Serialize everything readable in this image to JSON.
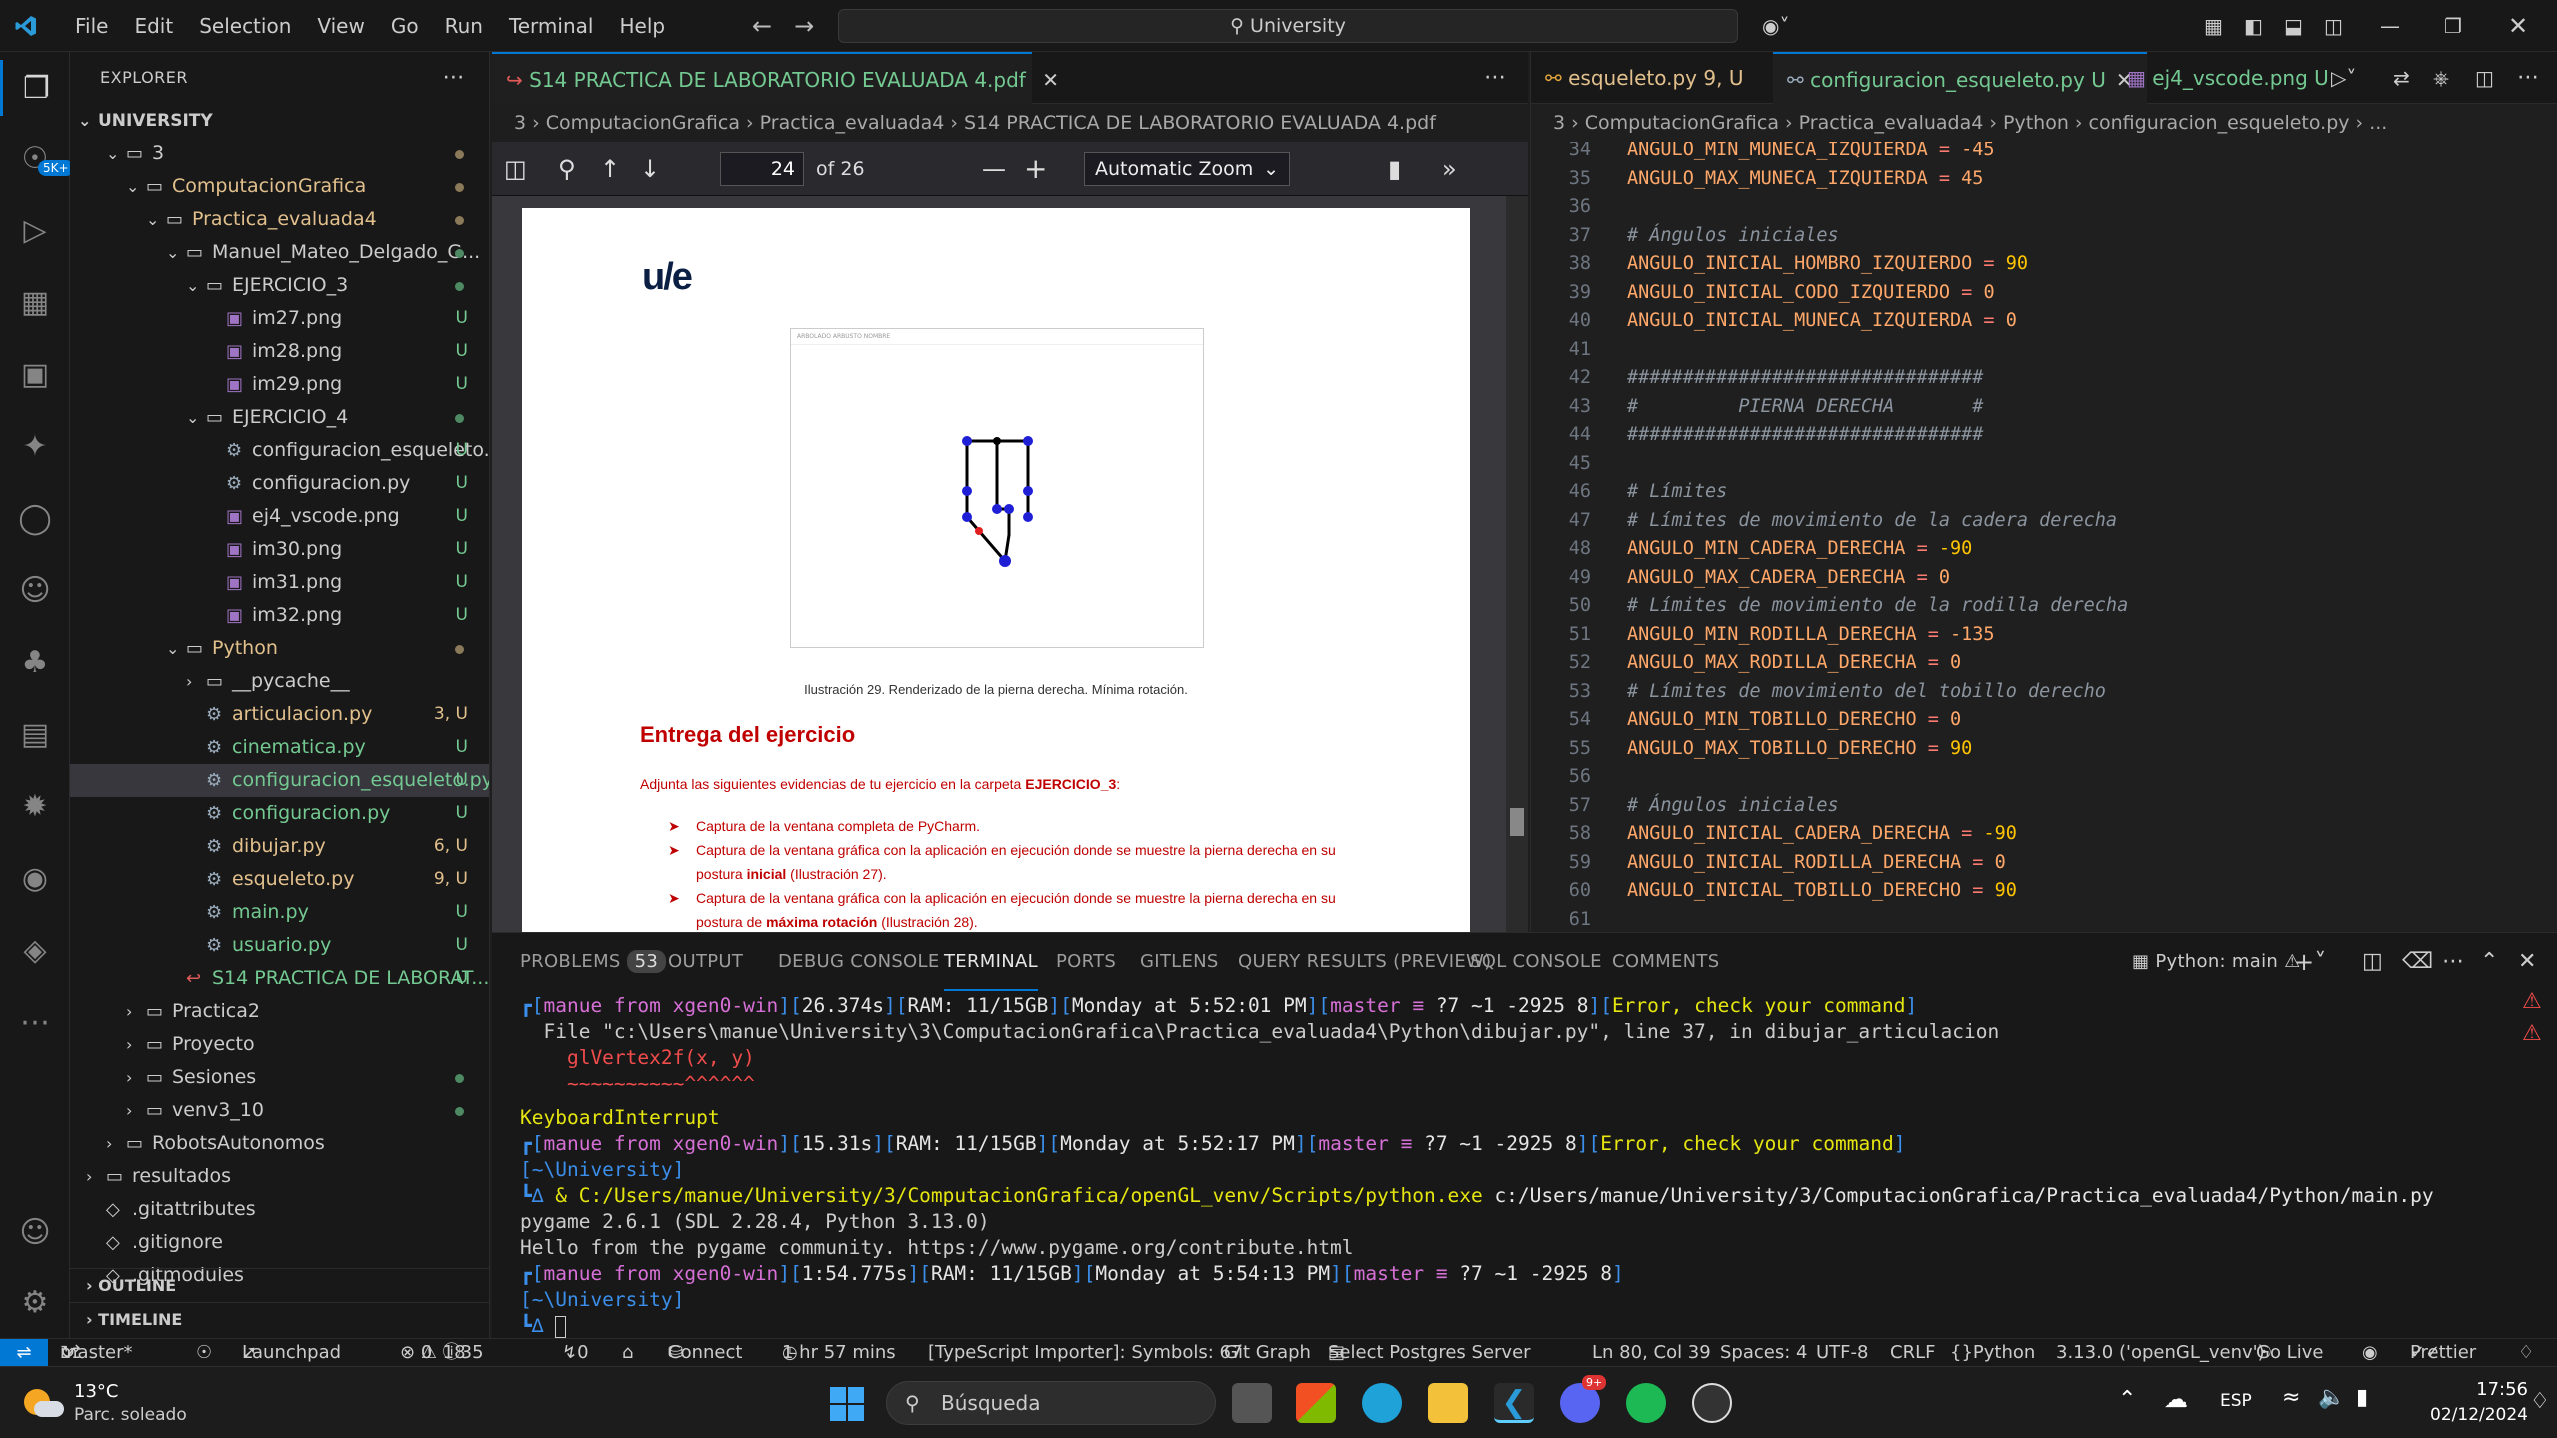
{
  "titlebar": {
    "menu": [
      "File",
      "Edit",
      "Selection",
      "View",
      "Go",
      "Run",
      "Terminal",
      "Help"
    ],
    "search": "University"
  },
  "activity": {
    "badge": "5K+"
  },
  "explorer": {
    "header": "EXPLORER",
    "root": "UNIVERSITY",
    "items": [
      {
        "label": "3",
        "indent": 1,
        "type": "folder",
        "dot": "mod"
      },
      {
        "label": "ComputacionGrafica",
        "indent": 2,
        "type": "folder",
        "dot": "mod",
        "color": "mod"
      },
      {
        "label": "Practica_evaluada4",
        "indent": 3,
        "type": "folder",
        "dot": "mod",
        "color": "mod"
      },
      {
        "label": "Manuel_Mateo_Delgado_G...",
        "indent": 4,
        "type": "folder",
        "dot": "unt"
      },
      {
        "label": "EJERCICIO_3",
        "indent": 5,
        "type": "folder",
        "dot": "unt"
      },
      {
        "label": "im27.png",
        "indent": 6,
        "type": "png",
        "status": "U"
      },
      {
        "label": "im28.png",
        "indent": 6,
        "type": "png",
        "status": "U"
      },
      {
        "label": "im29.png",
        "indent": 6,
        "type": "png",
        "status": "U"
      },
      {
        "label": "EJERCICIO_4",
        "indent": 5,
        "type": "folder",
        "dot": "unt"
      },
      {
        "label": "configuracion_esqueleto....",
        "indent": 6,
        "type": "py",
        "status": "U"
      },
      {
        "label": "configuracion.py",
        "indent": 6,
        "type": "py",
        "status": "U"
      },
      {
        "label": "ej4_vscode.png",
        "indent": 6,
        "type": "png",
        "status": "U"
      },
      {
        "label": "im30.png",
        "indent": 6,
        "type": "png",
        "status": "U"
      },
      {
        "label": "im31.png",
        "indent": 6,
        "type": "png",
        "status": "U"
      },
      {
        "label": "im32.png",
        "indent": 6,
        "type": "png",
        "status": "U"
      },
      {
        "label": "Python",
        "indent": 4,
        "type": "folder",
        "dot": "mod",
        "color": "mod"
      },
      {
        "label": "__pycache__",
        "indent": 5,
        "type": "folder"
      },
      {
        "label": "articulacion.py",
        "indent": 5,
        "type": "py",
        "status": "3, U",
        "color": "mod"
      },
      {
        "label": "cinematica.py",
        "indent": 5,
        "type": "py",
        "status": "U",
        "color": "unt"
      },
      {
        "label": "configuracion_esqueleto.py",
        "indent": 5,
        "type": "py",
        "status": "U",
        "color": "unt",
        "selected": true
      },
      {
        "label": "configuracion.py",
        "indent": 5,
        "type": "py",
        "status": "U",
        "color": "unt"
      },
      {
        "label": "dibujar.py",
        "indent": 5,
        "type": "py",
        "status": "6, U",
        "color": "mod"
      },
      {
        "label": "esqueleto.py",
        "indent": 5,
        "type": "py",
        "status": "9, U",
        "color": "mod"
      },
      {
        "label": "main.py",
        "indent": 5,
        "type": "py",
        "status": "U",
        "color": "unt"
      },
      {
        "label": "usuario.py",
        "indent": 5,
        "type": "py",
        "status": "U",
        "color": "unt"
      },
      {
        "label": "S14 PRACTICA DE LABORAT...",
        "indent": 4,
        "type": "pdf",
        "status": "U",
        "color": "unt"
      },
      {
        "label": "Practica2",
        "indent": 2,
        "type": "folder"
      },
      {
        "label": "Proyecto",
        "indent": 2,
        "type": "folder"
      },
      {
        "label": "Sesiones",
        "indent": 2,
        "type": "folder",
        "dot": "unt"
      },
      {
        "label": "venv3_10",
        "indent": 2,
        "type": "folder",
        "dot": "unt"
      },
      {
        "label": "RobotsAutonomos",
        "indent": 1,
        "type": "folder"
      },
      {
        "label": "resultados",
        "indent": 0,
        "type": "folder"
      },
      {
        "label": ".gitattributes",
        "indent": 0,
        "type": "git"
      },
      {
        "label": ".gitignore",
        "indent": 0,
        "type": "git"
      },
      {
        "label": ".gitmodules",
        "indent": 0,
        "type": "git"
      }
    ],
    "outline": "OUTLINE",
    "timeline": "TIMELINE"
  },
  "pdf": {
    "tab": "S14 PRACTICA DE LABORATORIO EVALUADA 4.pdf",
    "crumbs": "3 › ComputacionGrafica › Practica_evaluada4 › S14 PRACTICA DE LABORATORIO EVALUADA 4.pdf",
    "page": "24",
    "of": "of 26",
    "zoom": "Automatic Zoom",
    "logo": "u/e",
    "figure_window_title": "ARBOLADO ARBUSTO NOMBRE",
    "caption": "Ilustración 29. Renderizado de la pierna derecha. Mínima rotación.",
    "heading": "Entrega del ejercicio",
    "intro": "Adjunta las siguientes evidencias de tu ejercicio en la carpeta ",
    "intro_bold": "EJERCICIO_3",
    "bullets": [
      {
        "a": "Captura de la ventana completa de PyCharm.",
        "b": "",
        "c": ""
      },
      {
        "a": "Captura de la ventana gráfica con la aplicación en ejecución donde se muestre la pierna derecha en su postura ",
        "b": "inicial",
        "c": " (Ilustración 27)."
      },
      {
        "a": "Captura de la ventana gráfica con la aplicación en ejecución donde se muestre la pierna derecha en su postura de ",
        "b": "máxima rotación",
        "c": " (Ilustración 28)."
      }
    ]
  },
  "code": {
    "tabs": [
      {
        "label": "esqueleto.py",
        "status": "9, U"
      },
      {
        "label": "configuracion_esqueleto.py",
        "status": "U"
      },
      {
        "label": "ej4_vscode.png",
        "status": "U"
      }
    ],
    "crumbs": "3 › ComputacionGrafica › Practica_evaluada4 › Python › configuracion_esqueleto.py › ...",
    "lines": [
      {
        "n": "34",
        "t": "const",
        "name": "ANGULO_MIN_MUNECA_IZQUIERDA",
        "v": "-45"
      },
      {
        "n": "35",
        "t": "const",
        "name": "ANGULO_MAX_MUNECA_IZQUIERDA",
        "v": "45"
      },
      {
        "n": "36",
        "t": "blank"
      },
      {
        "n": "37",
        "t": "cmt",
        "text": "# Ángulos iniciales"
      },
      {
        "n": "38",
        "t": "const",
        "name": "ANGULO_INICIAL_HOMBRO_IZQUIERDO",
        "v": "90"
      },
      {
        "n": "39",
        "t": "const",
        "name": "ANGULO_INICIAL_CODO_IZQUIERDO",
        "v": "0"
      },
      {
        "n": "40",
        "t": "const",
        "name": "ANGULO_INICIAL_MUNECA_IZQUIERDA",
        "v": "0"
      },
      {
        "n": "41",
        "t": "blank"
      },
      {
        "n": "42",
        "t": "cmt",
        "text": "################################"
      },
      {
        "n": "43",
        "t": "cmt",
        "text": "#         PIERNA DERECHA       #"
      },
      {
        "n": "44",
        "t": "cmt",
        "text": "################################"
      },
      {
        "n": "45",
        "t": "blank"
      },
      {
        "n": "46",
        "t": "cmt",
        "text": "# Límites"
      },
      {
        "n": "47",
        "t": "cmt",
        "text": "# Límites de movimiento de la cadera derecha"
      },
      {
        "n": "48",
        "t": "const",
        "name": "ANGULO_MIN_CADERA_DERECHA",
        "v": "-90"
      },
      {
        "n": "49",
        "t": "const",
        "name": "ANGULO_MAX_CADERA_DERECHA",
        "v": "0"
      },
      {
        "n": "50",
        "t": "cmt",
        "text": "# Límites de movimiento de la rodilla derecha"
      },
      {
        "n": "51",
        "t": "const",
        "name": "ANGULO_MIN_RODILLA_DERECHA",
        "v": "-135"
      },
      {
        "n": "52",
        "t": "const",
        "name": "ANGULO_MAX_RODILLA_DERECHA",
        "v": "0"
      },
      {
        "n": "53",
        "t": "cmt",
        "text": "# Límites de movimiento del tobillo derecho"
      },
      {
        "n": "54",
        "t": "const",
        "name": "ANGULO_MIN_TOBILLO_DERECHO",
        "v": "0"
      },
      {
        "n": "55",
        "t": "const",
        "name": "ANGULO_MAX_TOBILLO_DERECHO",
        "v": "90"
      },
      {
        "n": "56",
        "t": "blank"
      },
      {
        "n": "57",
        "t": "cmt",
        "text": "# Ángulos iniciales"
      },
      {
        "n": "58",
        "t": "const",
        "name": "ANGULO_INICIAL_CADERA_DERECHA",
        "v": "-90"
      },
      {
        "n": "59",
        "t": "const",
        "name": "ANGULO_INICIAL_RODILLA_DERECHA",
        "v": "0"
      },
      {
        "n": "60",
        "t": "const",
        "name": "ANGULO_INICIAL_TOBILLO_DERECHO",
        "v": "90"
      },
      {
        "n": "61",
        "t": "blank"
      }
    ]
  },
  "panel": {
    "tabs": [
      "PROBLEMS",
      "OUTPUT",
      "DEBUG CONSOLE",
      "TERMINAL",
      "PORTS",
      "GITLENS",
      "QUERY RESULTS (PREVIEW)",
      "SQL CONSOLE",
      "COMMENTS"
    ],
    "problems_count": "53",
    "active": "TERMINAL",
    "shell": "Python: main",
    "terminal": {
      "l1_time": "26.374s",
      "l1_day": "Monday at 5:52:01 PM",
      "ram": "RAM: 11/15GB",
      "user": "manue from",
      "host": "xgen0-win",
      "branch": "master ≡",
      "gitinfo": "?7 ~1 -2925",
      "num": "8",
      "err": "Error, check your command",
      "file_line": "  File \"c:\\Users\\manue\\University\\3\\ComputacionGrafica\\Practica_evaluada4\\Python\\dibujar.py\", line 37, in dibujar_articulacion",
      "code_line": "    glVertex2f(x, y)",
      "caret_line": "    ~~~~~~~~~~^^^^^^",
      "kbi": "KeyboardInterrupt",
      "l2_time": "15.31s",
      "l2_day": "Monday at 5:52:17 PM",
      "cwd": "[~\\University]",
      "cmd_amp": "& ",
      "cmd_exe": "C:/Users/manue/University/3/ComputacionGrafica/openGL_venv/Scripts/python.exe",
      "cmd_arg": " c:/Users/manue/University/3/ComputacionGrafica/Practica_evaluada4/Python/main.py",
      "pygame1": "pygame 2.6.1 (SDL 2.28.4, Python 3.13.0)",
      "pygame2": "Hello from the pygame community. https://www.pygame.org/contribute.html",
      "l3_time": "1:54.775s",
      "l3_day": "Monday at 5:54:13 PM"
    }
  },
  "status": {
    "branch": "master*",
    "launchpad": "Launchpad",
    "errors": "0",
    "warnings": "18",
    "infos": "35",
    "ports": "0",
    "connect": "Connect",
    "time": "1 hr 57 mins",
    "ts": "[TypeScript Importer]: Symbols: 67",
    "gitgraph": "Git Graph",
    "postgres": "Select Postgres Server",
    "cursor": "Ln 80, Col 39",
    "spaces": "Spaces: 4",
    "enc": "UTF-8",
    "eol": "CRLF",
    "lang": "Python",
    "pyver": "3.13.0 ('openGL_venv')",
    "golive": "Go Live",
    "prettier": "Prettier"
  },
  "taskbar": {
    "temp": "13°C",
    "weather": "Parc. soleado",
    "search": "Búsqueda",
    "lang": "ESP",
    "time": "17:56",
    "date": "02/12/2024",
    "discord_badge": "9+"
  },
  "colors": {
    "accent": "#0078d4",
    "modified": "#e2c08d",
    "untracked": "#73c991",
    "pdf_red": "#c00000"
  }
}
